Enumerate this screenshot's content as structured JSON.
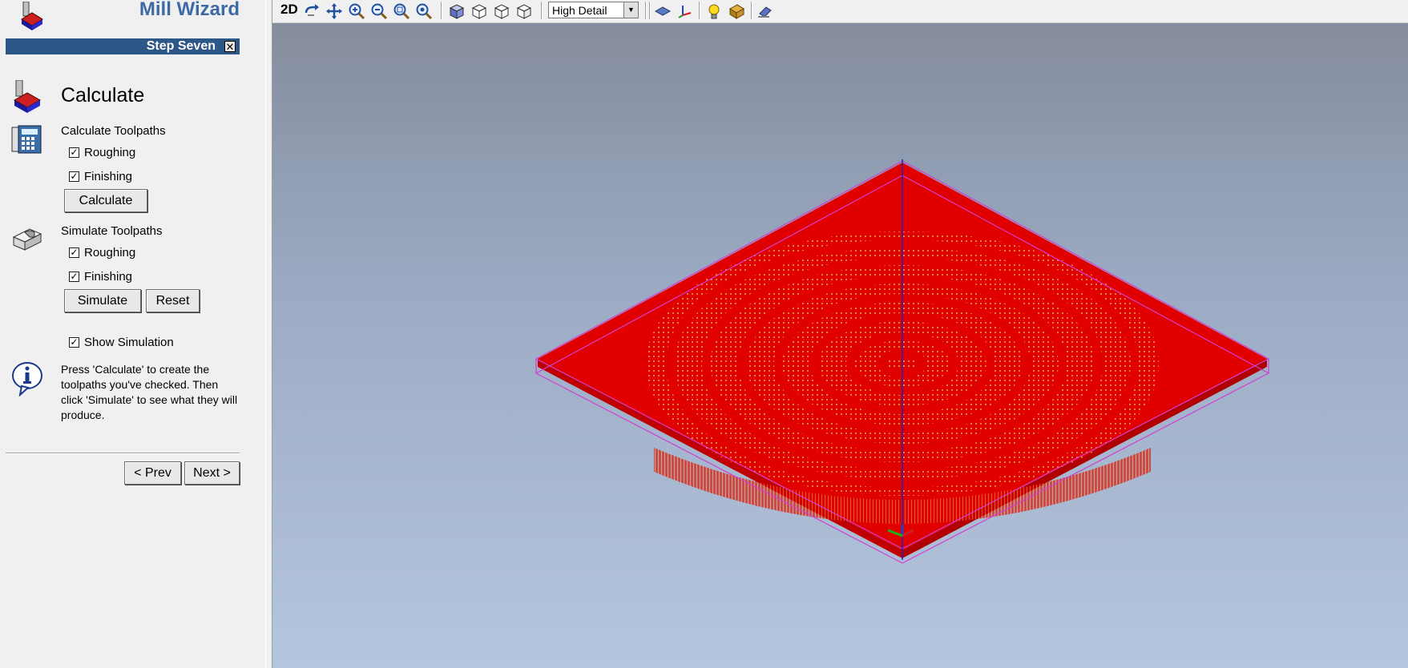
{
  "app": {
    "title": "Mill Wizard"
  },
  "step": {
    "label": "Step Seven",
    "close_glyph": "✕"
  },
  "section": {
    "title": "Calculate"
  },
  "calculate": {
    "heading": "Calculate Toolpaths",
    "roughing": {
      "label": "Roughing",
      "checked": true
    },
    "finishing": {
      "label": "Finishing",
      "checked": true
    },
    "button": "Calculate"
  },
  "simulate": {
    "heading": "Simulate Toolpaths",
    "roughing": {
      "label": "Roughing",
      "checked": true
    },
    "finishing": {
      "label": "Finishing",
      "checked": true
    },
    "simulate_button": "Simulate",
    "reset_button": "Reset"
  },
  "show_simulation": {
    "label": "Show Simulation",
    "checked": true
  },
  "help": {
    "text": "Press 'Calculate' to create the toolpaths you've checked. Then click 'Simulate' to see what they will produce."
  },
  "nav": {
    "prev": "< Prev",
    "next": "Next >"
  },
  "toolbar": {
    "mode_2d": "2D",
    "detail_value": "High Detail",
    "icons": [
      "rotate-icon",
      "pan-icon",
      "zoom-in-icon",
      "zoom-out-icon",
      "zoom-window-icon",
      "zoom-fit-icon",
      "iso-view-icon",
      "front-view-icon",
      "top-view-icon",
      "side-view-icon",
      "plane-icon",
      "axes-icon",
      "light-icon",
      "material-icon",
      "eraser-icon"
    ]
  },
  "colors": {
    "accent": "#2d5787",
    "title": "#3d6aa5",
    "toolpath": "#e00000",
    "finishing": "#e8a040",
    "stock_outline": "#d040d0"
  }
}
